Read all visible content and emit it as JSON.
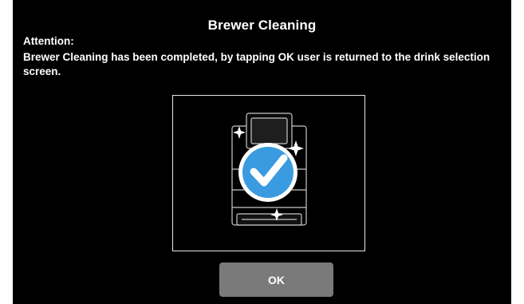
{
  "dialog": {
    "title": "Brewer Cleaning",
    "attention_label": "Attention:",
    "message": "Brewer Cleaning has been completed, by tapping OK user is returned to the drink selection screen.",
    "ok_label": "OK"
  },
  "illustration": {
    "machine_icon": "coffee-machine-icon",
    "check_icon": "checkmark-icon",
    "sparkle_icon": "sparkle-icon"
  },
  "colors": {
    "background": "#000000",
    "text": "#ffffff",
    "button": "#7a7a7a",
    "check_circle": "#3a9be0"
  }
}
